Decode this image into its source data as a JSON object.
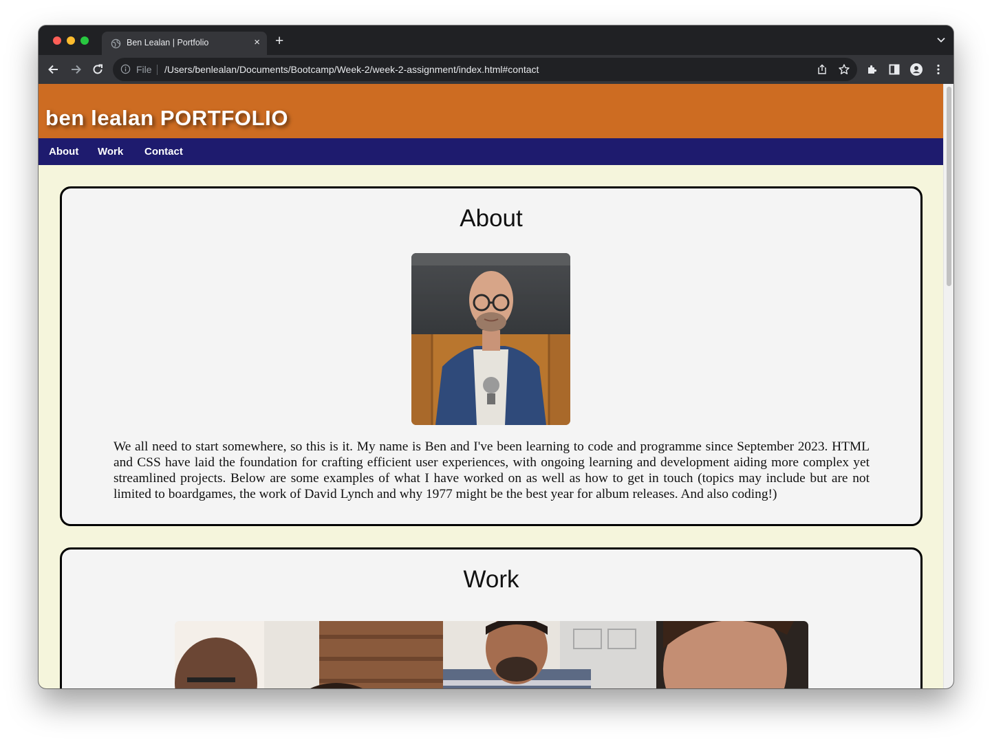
{
  "browser": {
    "tab_title": "Ben Lealan | Portfolio",
    "new_tab_glyph": "+",
    "close_glyph": "×",
    "scheme_label": "File",
    "url": "/Users/benlealan/Documents/Bootcamp/Week-2/week-2-assignment/index.html#contact",
    "icons": [
      "globe-icon",
      "back-arrow-icon",
      "forward-arrow-icon",
      "reload-icon",
      "info-icon",
      "share-icon",
      "bookmark-star-icon",
      "extensions-puzzle-icon",
      "side-panel-icon",
      "profile-icon",
      "more-menu-icon",
      "tab-search-chevron-icon"
    ]
  },
  "site": {
    "title": "ben lealan PORTFOLIO",
    "header_color": "#cd6c22",
    "nav_color": "#1e1b6e",
    "background_color": "#f5f5dc",
    "nav": [
      {
        "label": "About"
      },
      {
        "label": "Work"
      },
      {
        "label": "Contact"
      }
    ]
  },
  "about": {
    "heading": "About",
    "photo_description": "portrait-photo",
    "text": "We all need to start somewhere, so this is it. My name is Ben and I've been learning to code and programme since September 2023. HTML and CSS have laid the foundation for crafting efficient user experiences, with ongoing learning and development aiding more complex yet streamlined projects. Below are some examples of what I have worked on as well as how to get in touch (topics may include but are not limited to boardgames, the work of David Lynch and why 1977 might be the best year for album releases. And also coding!)"
  },
  "work": {
    "heading": "Work",
    "photo_description": "team-collaboration-photo"
  }
}
